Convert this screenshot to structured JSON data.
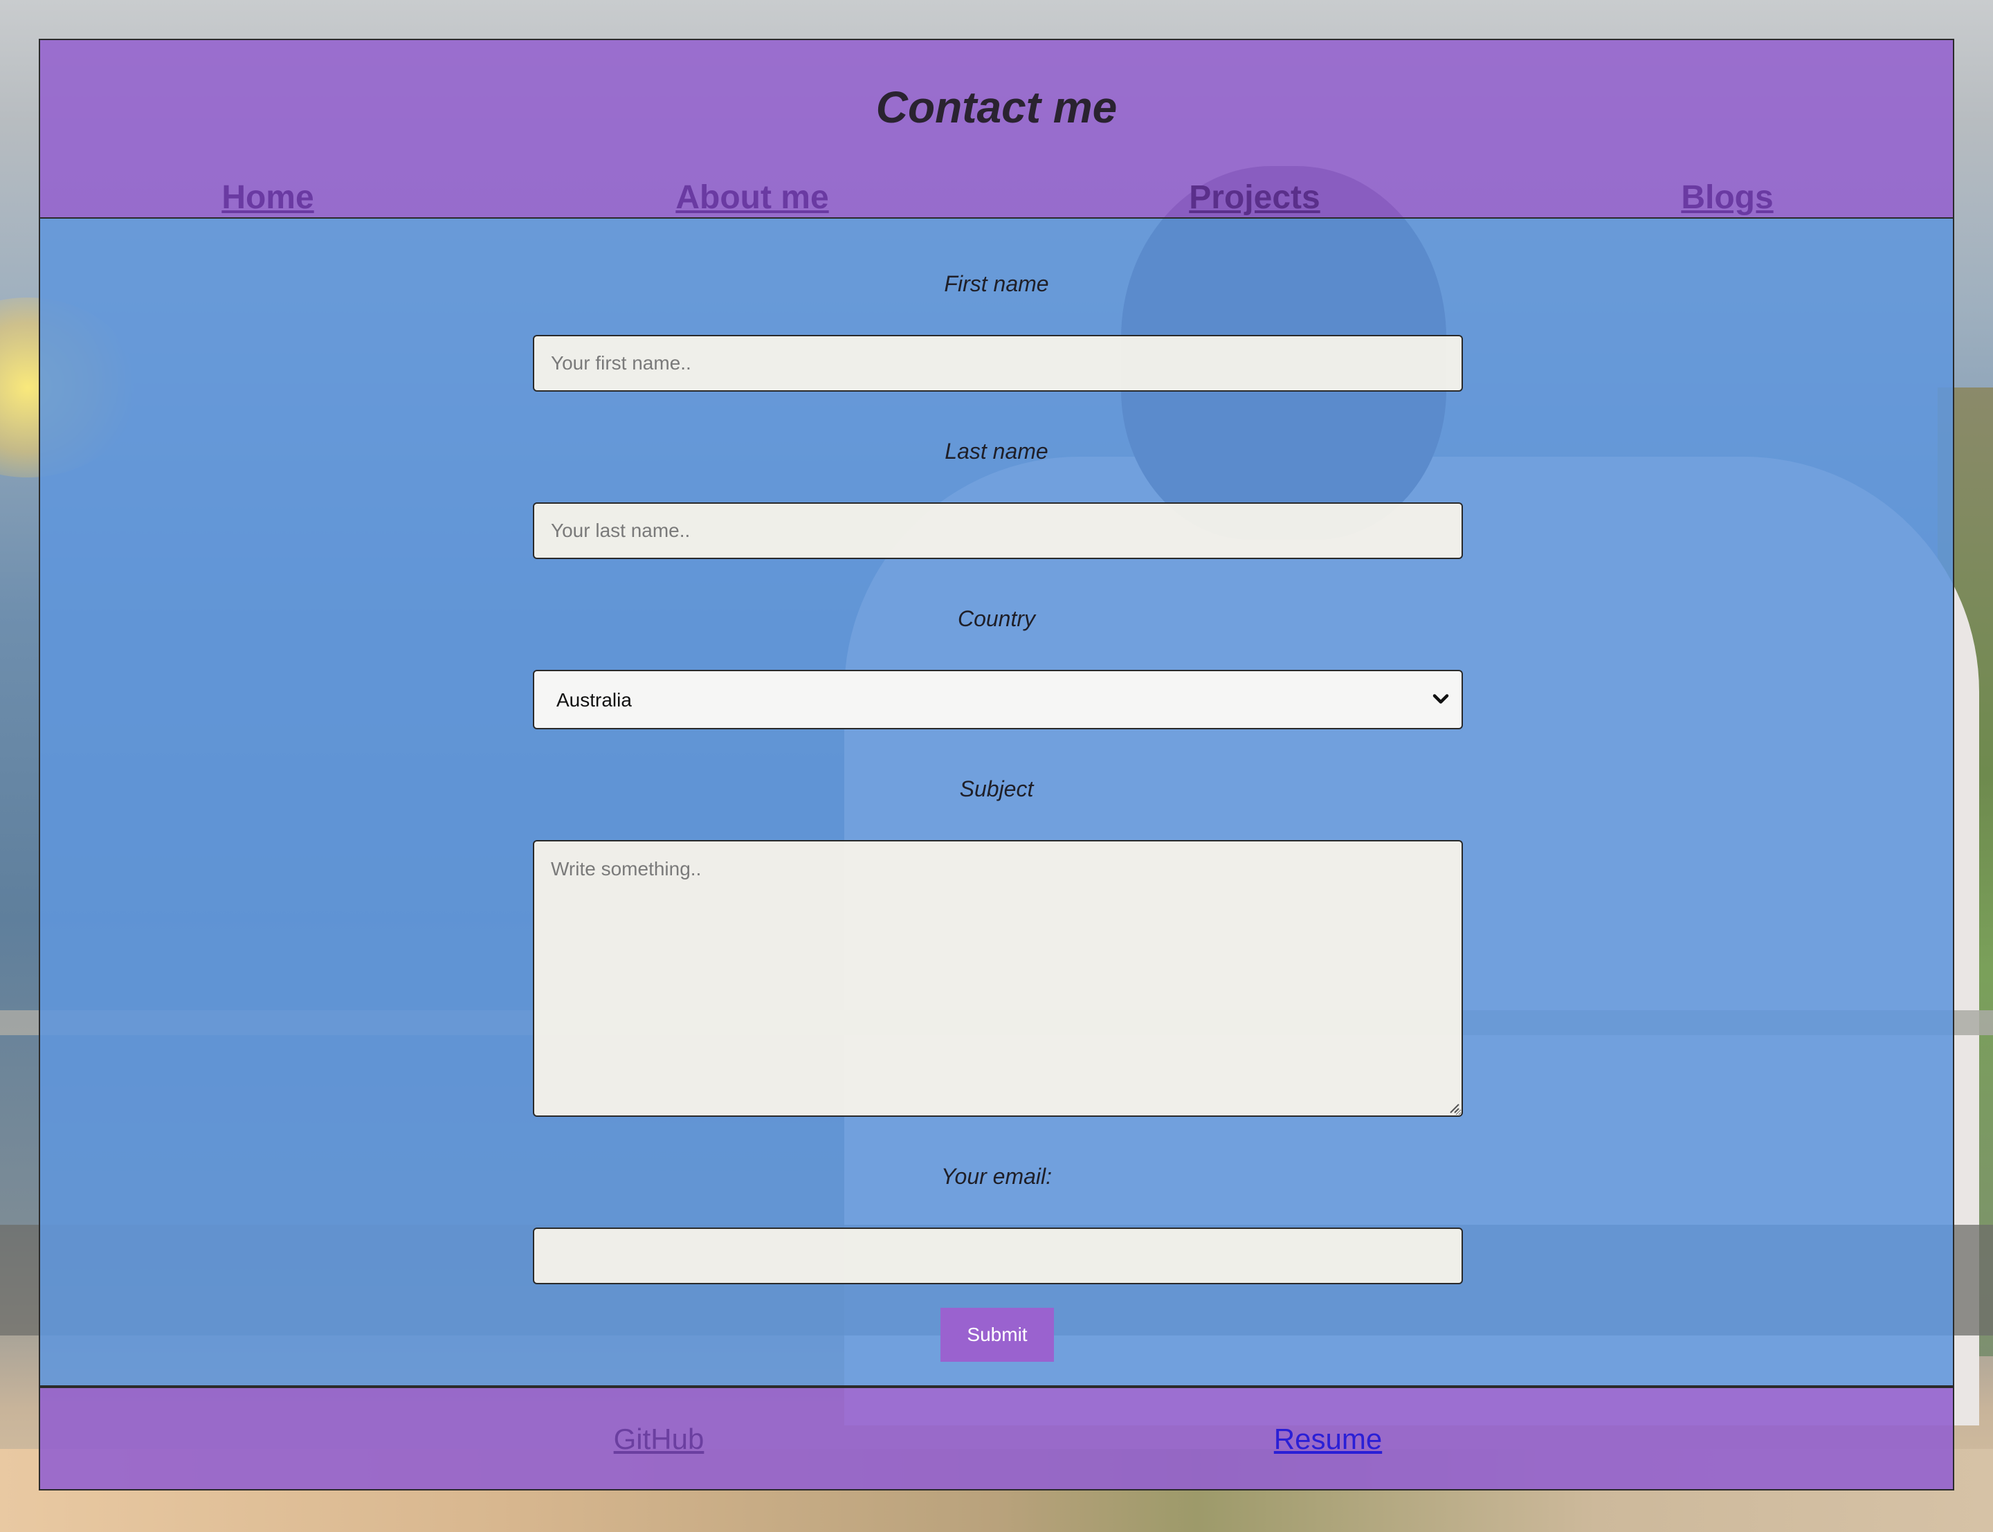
{
  "header": {
    "title": "Contact me",
    "nav": [
      {
        "label": "Home"
      },
      {
        "label": "About me"
      },
      {
        "label": "Projects"
      },
      {
        "label": "Blogs"
      }
    ]
  },
  "form": {
    "first_name": {
      "label": "First name",
      "placeholder": "Your first name..",
      "value": ""
    },
    "last_name": {
      "label": "Last name",
      "placeholder": "Your last name..",
      "value": ""
    },
    "country": {
      "label": "Country",
      "selected": "Australia"
    },
    "subject": {
      "label": "Subject",
      "placeholder": "Write something..",
      "value": ""
    },
    "email": {
      "label": "Your email:",
      "value": ""
    },
    "submit_label": "Submit"
  },
  "footer": {
    "links": [
      {
        "label": "GitHub"
      },
      {
        "label": "Resume"
      }
    ]
  },
  "colors": {
    "header_bg": "#9462ce",
    "main_bg": "#6096dc",
    "submit_bg": "#9a62cf",
    "nav_link": "#6a3aa2",
    "resume_link": "#2a1fd6"
  }
}
